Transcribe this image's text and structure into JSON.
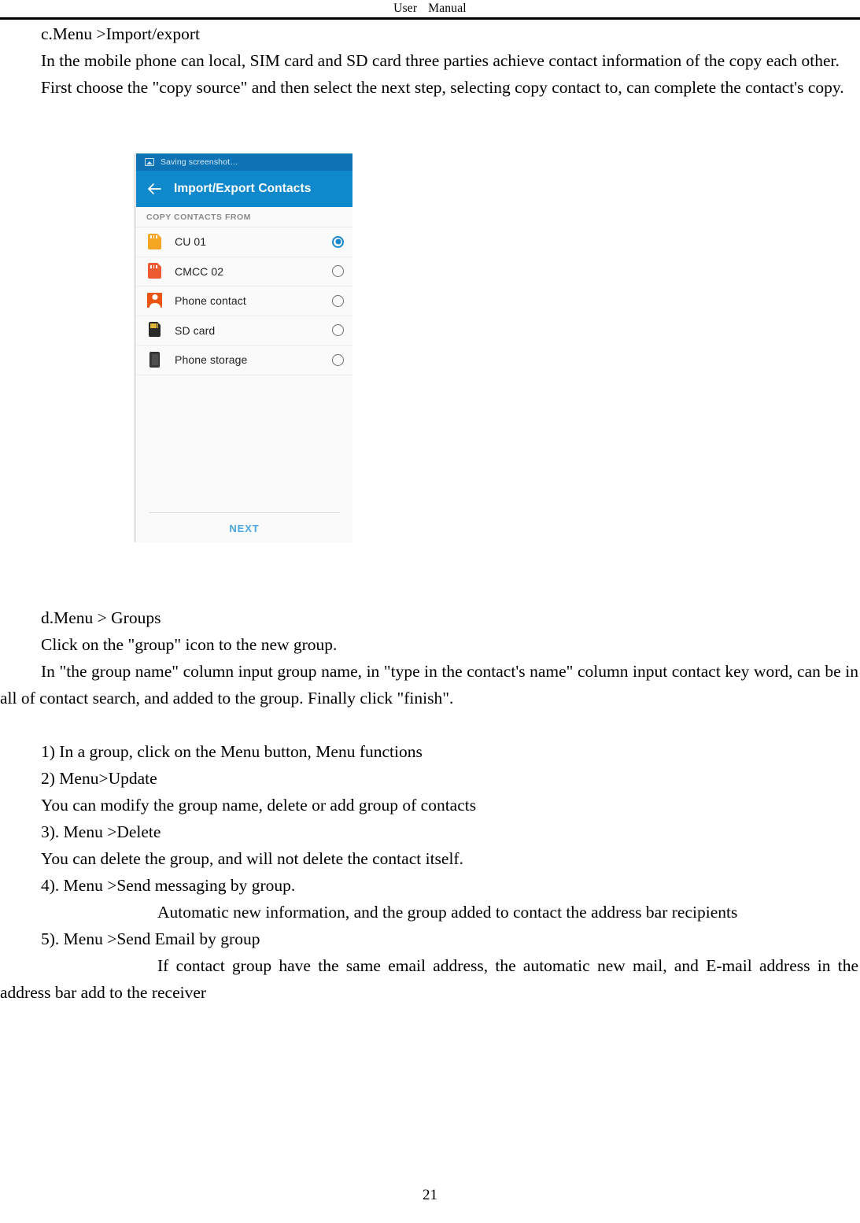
{
  "header": {
    "left_word": "User",
    "right_word": "Manual"
  },
  "document": {
    "section_c_heading": "c.Menu >Import/export",
    "paragraph_1": "In the mobile phone can local, SIM card and SD card three parties achieve contact information of the copy each other.",
    "paragraph_2": "First choose the \"copy source\" and then select the next step, selecting copy contact to, can complete the contact's copy.",
    "section_d_heading": "d.Menu > Groups",
    "paragraph_3": "Click on the \"group\" icon to the new group.",
    "paragraph_4": "In \"the group name\" column input group name, in \"type in the contact's name\" column input contact key word, can be in all of contact search, and added to the group. Finally click \"finish\".",
    "list_items": [
      "1)    In a group, click on the Menu button,    Menu functions",
      "2)    Menu>Update",
      "You can modify the group name, delete or add group of contacts",
      "3).    Menu >Delete",
      "You can delete the group, and will not delete the contact itself.",
      "4).    Menu >Send messaging by group.",
      "Automatic new information, and the group added to contact the address bar recipients",
      "5).    Menu >Send Email by group",
      "If contact group have the same email address, the automatic new mail, and E-mail address in the address bar add to the receiver"
    ],
    "page_number": "21"
  },
  "phone_screenshot": {
    "status_bar": {
      "icon": "screenshot-image-icon",
      "text": "Saving screenshot…"
    },
    "app_bar": {
      "back_icon": "back-arrow-icon",
      "title": "Import/Export Contacts"
    },
    "section_label": "COPY CONTACTS FROM",
    "options": [
      {
        "label": "CU 01",
        "icon": "sim-card-icon",
        "icon_color": "#f6a623",
        "selected": true
      },
      {
        "label": "CMCC 02",
        "icon": "sim-card-icon",
        "icon_color": "#ee5b32",
        "selected": false
      },
      {
        "label": "Phone contact",
        "icon": "person-contact-icon",
        "icon_color": "#ea5514",
        "selected": false
      },
      {
        "label": "SD card",
        "icon": "sd-card-icon",
        "icon_color": "#2a2a2a",
        "selected": false
      },
      {
        "label": "Phone storage",
        "icon": "phone-storage-icon",
        "icon_color": "#3a3a3a",
        "selected": false
      }
    ],
    "next_button": "NEXT",
    "colors": {
      "status_bar": "#0e73b4",
      "app_bar": "#0f88cc",
      "accent": "#1787ce",
      "next_label": "#49a6e0",
      "list_background": "#fafafa"
    }
  }
}
